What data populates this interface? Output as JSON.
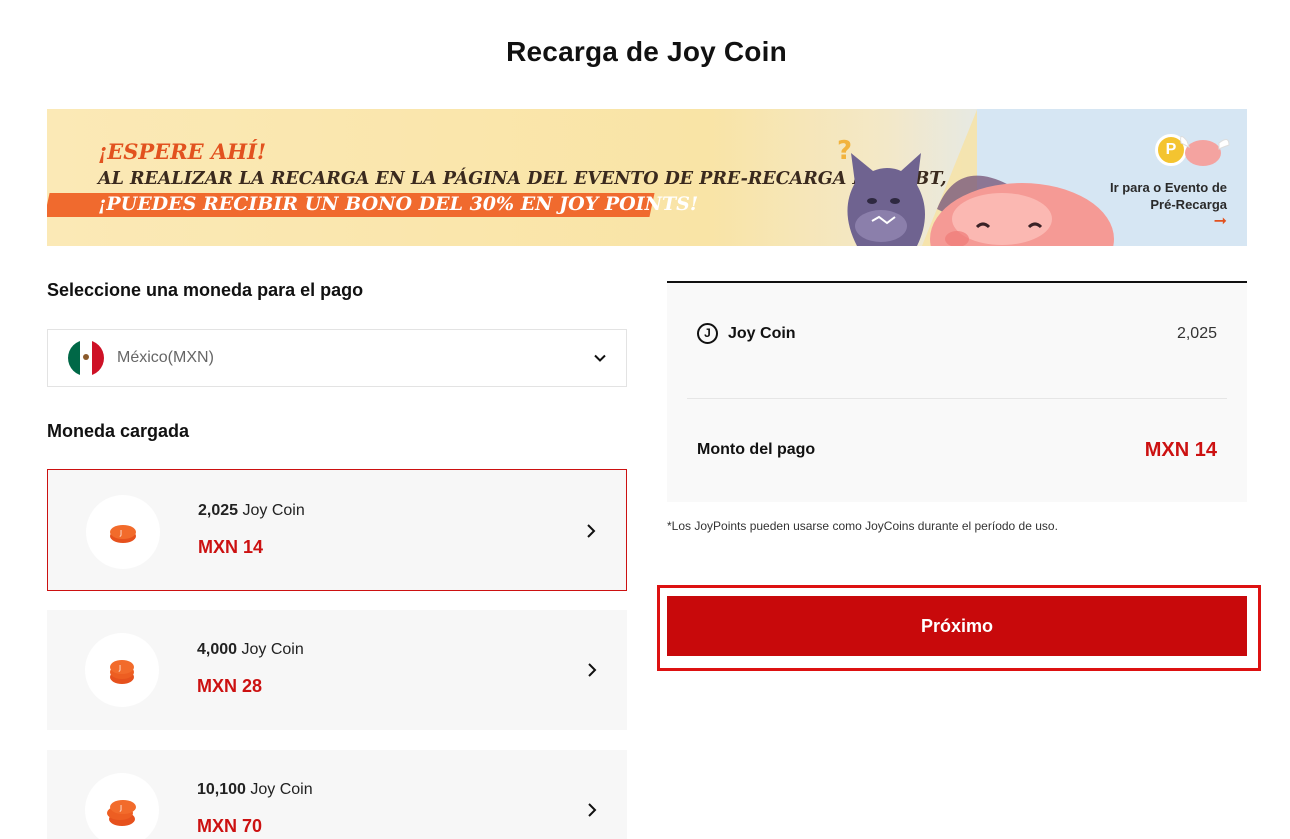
{
  "page": {
    "title": "Recarga de Joy Coin"
  },
  "banner": {
    "line1": "¡ESPERE AHÍ!",
    "line2": "AL REALIZAR LA RECARGA EN LA PÁGINA DEL EVENTO DE PRE-RECARGA DEL OBT,",
    "line3": "¡PUEDES RECIBIR UN BONO DEL 30% EN JOY POINTS!",
    "cta_line1": "Ir para o Evento de",
    "cta_line2": "Pré-Recarga",
    "cta_arrow": "➞",
    "badge": "P"
  },
  "currency": {
    "label": "Seleccione una moneda para el pago",
    "selected": "México(MXN)",
    "flag_icon": "mexico-flag-icon"
  },
  "packages": {
    "label": "Moneda cargada",
    "items": [
      {
        "amount": "2,025",
        "unit": " Joy Coin",
        "price": "MXN 14",
        "selected": true
      },
      {
        "amount": "4,000",
        "unit": " Joy Coin",
        "price": "MXN 28",
        "selected": false
      },
      {
        "amount": "10,100",
        "unit": " Joy Coin",
        "price": "MXN 70",
        "selected": false
      }
    ]
  },
  "summary": {
    "coin_icon": "J",
    "coin_label": "Joy Coin",
    "coin_value": "2,025",
    "payment_label": "Monto del pago",
    "payment_value": "MXN 14",
    "note": "*Los JoyPoints pueden usarse como JoyCoins durante el período de uso."
  },
  "actions": {
    "next_label": "Próximo"
  },
  "colors": {
    "accent": "#cc1111",
    "button": "#c8090b",
    "banner_orange": "#f06a2e"
  }
}
